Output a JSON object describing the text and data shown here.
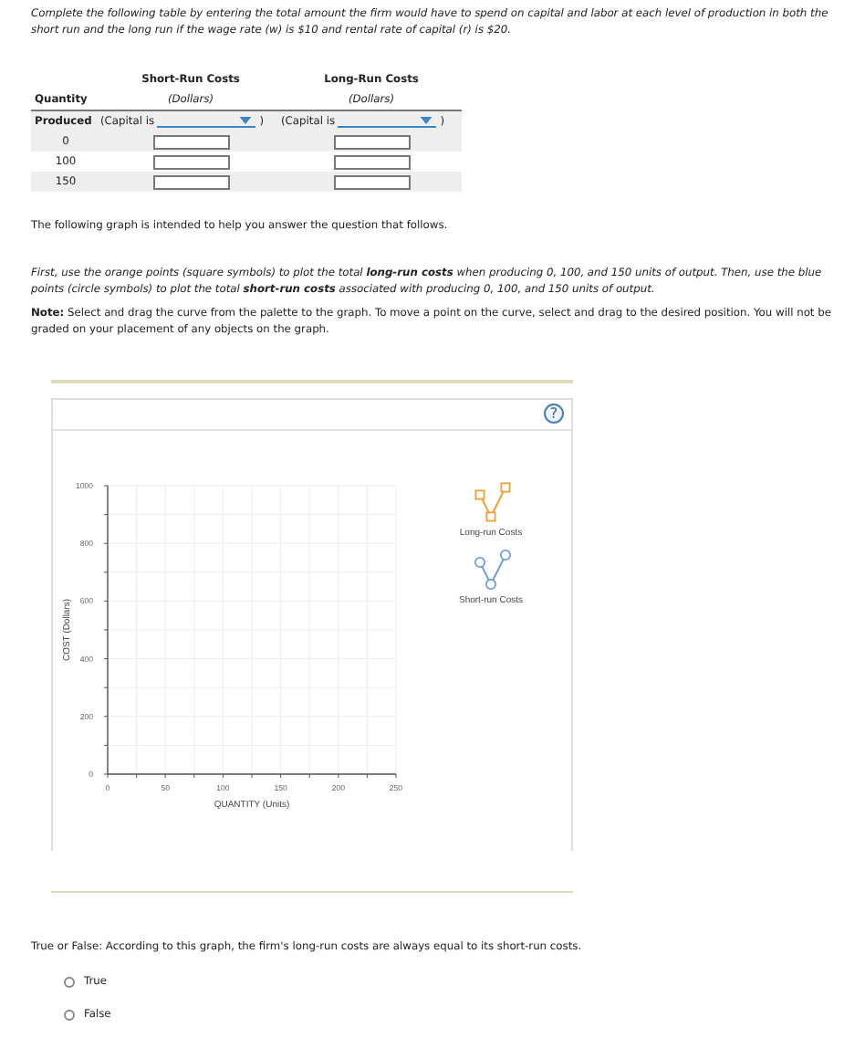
{
  "instructions": "Complete the following table by entering the total amount the firm would have to spend on capital and labor at each level of production in both the short run and the long run if the wage rate (w) is $10 and rental rate of capital (r) is $20.",
  "cost_table": {
    "quantity_header": [
      "Quantity",
      "Produced"
    ],
    "columns": [
      {
        "title": "Short-Run Costs",
        "unit": "(Dollars)",
        "capital_prefix": "(Capital is",
        "capital_suffix": ")"
      },
      {
        "title": "Long-Run Costs",
        "unit": "(Dollars)",
        "capital_prefix": "(Capital is",
        "capital_suffix": ")"
      }
    ],
    "rows": [
      {
        "quantity": "0"
      },
      {
        "quantity": "100"
      },
      {
        "quantity": "150"
      }
    ]
  },
  "graph_intro": "The following graph is intended to help you answer the question that follows.",
  "plot_instructions": "First, use the orange points (square symbols) to plot the total **long-run costs** when producing 0, 100, and 150 units of output. Then, use the blue points (circle symbols) to plot the total **short-run costs** associated with producing 0, 100, and 150 units of output.",
  "note": "**Note:** Select and drag the curve from the palette to the graph. To move a point on the curve, select and drag to the desired position. You will not be graded on your placement of any objects on the graph.",
  "graph": {
    "help": "?",
    "chart_data": {
      "type": "scatter",
      "grid": true,
      "xlabel": "QUANTITY (Units)",
      "ylabel": "COST (Dollars)",
      "xlim": [
        0,
        250
      ],
      "ylim": [
        0,
        1000
      ],
      "xticks": [
        0,
        50,
        100,
        150,
        200,
        250
      ],
      "yticks": [
        0,
        200,
        400,
        600,
        800,
        1000
      ]
    },
    "palette": [
      {
        "kind": "square",
        "label": "Long-run Costs",
        "color": "#f0a030"
      },
      {
        "kind": "circle",
        "label": "Short-run Costs",
        "color": "#6f9fd8"
      }
    ]
  },
  "question": "True or False: According to this graph, the firm's long-run costs are always equal to its short-run costs.",
  "options": [
    {
      "label": "True",
      "selected": false
    },
    {
      "label": "False",
      "selected": false
    }
  ]
}
